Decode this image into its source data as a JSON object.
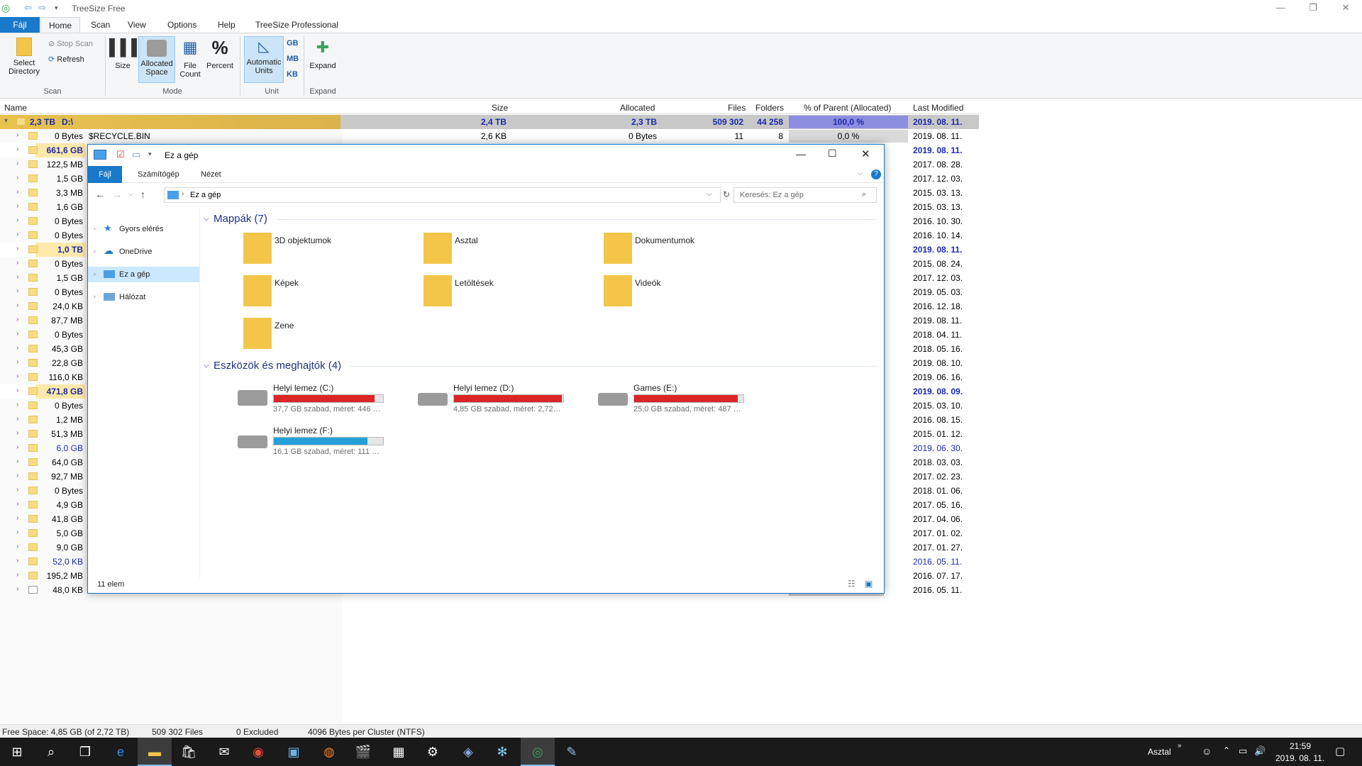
{
  "app": {
    "title": "TreeSize Free"
  },
  "ribbon_tabs": [
    "Fájl",
    "Home",
    "Scan",
    "View",
    "Options",
    "Help",
    "TreeSize Professional"
  ],
  "ribbon": {
    "select_directory": "Select Directory",
    "stop_scan": "Stop Scan",
    "refresh": "Refresh",
    "size": "Size",
    "allocated_space": "Allocated Space",
    "file_count": "File Count",
    "percent": "Percent",
    "automatic_units": "Automatic Units",
    "gb": "GB",
    "mb": "MB",
    "kb": "KB",
    "expand": "Expand",
    "groups": {
      "scan": "Scan",
      "mode": "Mode",
      "unit": "Unit",
      "expand": "Expand"
    }
  },
  "columns": {
    "name": "Name",
    "size": "Size",
    "allocated": "Allocated",
    "files": "Files",
    "folders": "Folders",
    "pct": "% of Parent (Allocated)",
    "last_modified": "Last Modified"
  },
  "root": {
    "size_label": "2,3 TB",
    "name": "D:\\",
    "size": "2,4 TB",
    "allocated": "2,3 TB",
    "files": "509 302",
    "folders": "44 258",
    "pct": "100,0 %",
    "last_modified": "2019. 08. 11."
  },
  "recycle": {
    "size_label": "0 Bytes",
    "name": "$RECYCLE.BIN",
    "size": "2,6 KB",
    "allocated": "0 Bytes",
    "files": "11",
    "folders": "8",
    "pct": "0,0 %",
    "last_modified": "2019. 08. 11."
  },
  "rows": [
    {
      "size": "661,6 GB",
      "date": "2019. 08. 11."
    },
    {
      "size": "122,5 MB",
      "date": "2017. 08. 28."
    },
    {
      "size": "1,5 GB",
      "date": "2017. 12. 03."
    },
    {
      "size": "3,3 MB",
      "date": "2015. 03. 13."
    },
    {
      "size": "1,6 GB",
      "date": "2015. 03. 13."
    },
    {
      "size": "0 Bytes",
      "date": "2016. 10. 30."
    },
    {
      "size": "0 Bytes",
      "date": "2016. 10. 14."
    },
    {
      "size": "1,0 TB",
      "date": "2019. 08. 11."
    },
    {
      "size": "0 Bytes",
      "date": "2015. 08. 24."
    },
    {
      "size": "1,5 GB",
      "date": "2017. 12. 03."
    },
    {
      "size": "0 Bytes",
      "date": "2019. 05. 03."
    },
    {
      "size": "24,0 KB",
      "date": "2016. 12. 18."
    },
    {
      "size": "87,7 MB",
      "date": "2019. 08. 11."
    },
    {
      "size": "0 Bytes",
      "date": "2018. 04. 11."
    },
    {
      "size": "45,3 GB",
      "date": "2018. 05. 16."
    },
    {
      "size": "22,8 GB",
      "date": "2019. 08. 10."
    },
    {
      "size": "116,0 KB",
      "date": "2019. 06. 16."
    },
    {
      "size": "471,8 GB",
      "date": "2019. 08. 09."
    },
    {
      "size": "0 Bytes",
      "date": "2015. 03. 10."
    },
    {
      "size": "1,2 MB",
      "date": "2016. 08. 15."
    },
    {
      "size": "51,3 MB",
      "date": "2015. 01. 12."
    },
    {
      "size": "6,0 GB",
      "date": "2019. 06. 30."
    },
    {
      "size": "64,0 GB",
      "date": "2018. 03. 03."
    },
    {
      "size": "92,7 MB",
      "date": "2017. 02. 23."
    },
    {
      "size": "0 Bytes",
      "date": "2018. 01. 06."
    },
    {
      "size": "4,9 GB",
      "date": "2017. 05. 16."
    },
    {
      "size": "41,8 GB",
      "date": "2017. 04. 06."
    },
    {
      "size": "5,0 GB",
      "date": "2017. 01. 02."
    },
    {
      "size": "9,0 GB",
      "date": "2017. 01. 27."
    },
    {
      "size": "52,0 KB",
      "date": "2016. 05. 11."
    },
    {
      "size": "195,2 MB",
      "date": "2016. 07. 17."
    },
    {
      "size": "48,0 KB",
      "date": "2016. 05. 11."
    }
  ],
  "status": {
    "free": "Free Space: 4,85 GB  (of 2,72 TB)",
    "files": "509 302  Files",
    "excluded": "0 Excluded",
    "cluster": "4096  Bytes per Cluster (NTFS)"
  },
  "explorer": {
    "title": "Ez a gép",
    "tabs": [
      "Fájl",
      "Számítógép",
      "Nézet"
    ],
    "address": "Ez a gép",
    "search_placeholder": "Keresés: Ez a gép",
    "nav": [
      "Gyors elérés",
      "OneDrive",
      "Ez a gép",
      "Hálózat"
    ],
    "folders_header": "Mappák (7)",
    "folders": [
      "3D objektumok",
      "Asztal",
      "Dokumentumok",
      "Képek",
      "Letöltések",
      "Videók",
      "Zene"
    ],
    "devices_header": "Eszközök és meghajtók (4)",
    "drives": [
      {
        "name": "Helyi lemez (C:)",
        "info": "37,7 GB szabad, méret: 446 …",
        "used": 0.92,
        "color": "#da2626"
      },
      {
        "name": "Helyi lemez (D:)",
        "info": "4,85 GB szabad, méret: 2,72…",
        "used": 0.99,
        "color": "#da2626"
      },
      {
        "name": "Games (E:)",
        "info": "25,0 GB szabad, méret: 487 …",
        "used": 0.95,
        "color": "#da2626"
      },
      {
        "name": "Helyi lemez (F:)",
        "info": "16,1 GB szabad, méret: 111 …",
        "used": 0.86,
        "color": "#26a0da"
      }
    ],
    "count": "11 elem"
  },
  "taskbar": {
    "desktop_label": "Asztal",
    "time": "21:59",
    "date": "2019. 08. 11."
  }
}
